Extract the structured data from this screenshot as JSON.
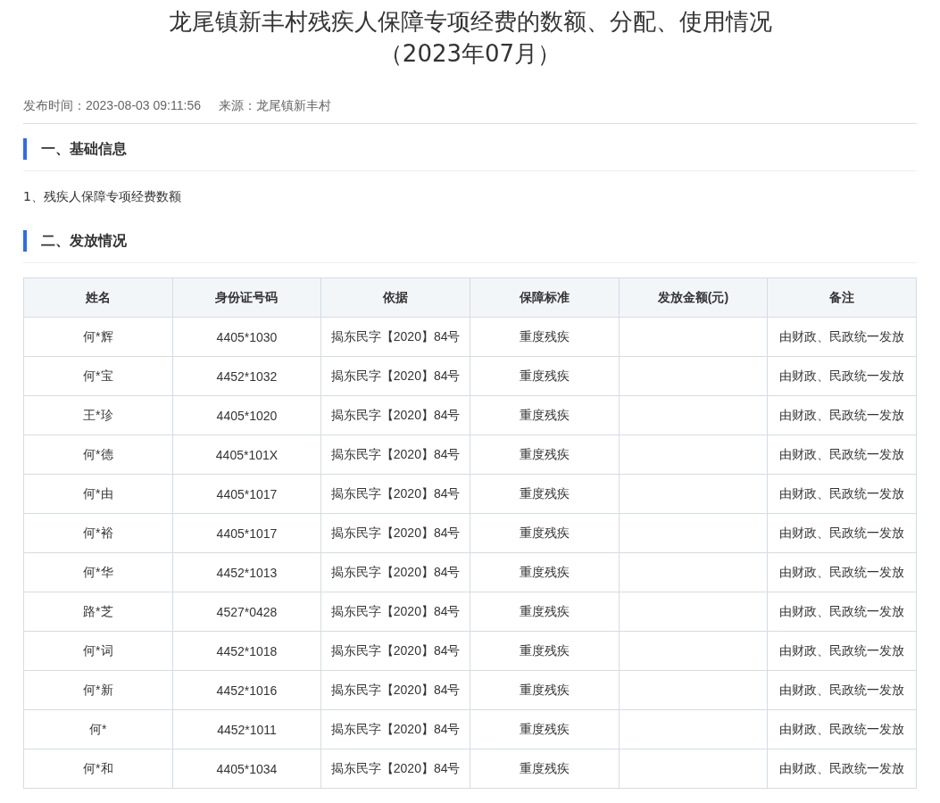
{
  "title_lines": [
    "龙尾镇新丰村残疾人保障专项经费的数额、分配、使用情况",
    "（2023年07月）"
  ],
  "meta": {
    "published": "发布时间：2023-08-03 09:11:56",
    "source": "来源：龙尾镇新丰村"
  },
  "sections": [
    {
      "heading": "一、基础信息",
      "kind": "text",
      "paragraphs": [
        "1、残疾人保障专项经费数额"
      ]
    },
    {
      "heading": "二、发放情况",
      "kind": "table",
      "table": {
        "columns": [
          "姓名",
          "身份证号码",
          "依据",
          "保障标准",
          "发放金额(元)",
          "备注"
        ],
        "rows": [
          [
            "何*辉",
            "4405*1030",
            "揭东民字【2020】84号",
            "重度残疾",
            "",
            "由财政、民政统一发放"
          ],
          [
            "何*宝",
            "4452*1032",
            "揭东民字【2020】84号",
            "重度残疾",
            "",
            "由财政、民政统一发放"
          ],
          [
            "王*珍",
            "4405*1020",
            "揭东民字【2020】84号",
            "重度残疾",
            "",
            "由财政、民政统一发放"
          ],
          [
            "何*德",
            "4405*101X",
            "揭东民字【2020】84号",
            "重度残疾",
            "",
            "由财政、民政统一发放"
          ],
          [
            "何*由",
            "4405*1017",
            "揭东民字【2020】84号",
            "重度残疾",
            "",
            "由财政、民政统一发放"
          ],
          [
            "何*裕",
            "4405*1017",
            "揭东民字【2020】84号",
            "重度残疾",
            "",
            "由财政、民政统一发放"
          ],
          [
            "何*华",
            "4452*1013",
            "揭东民字【2020】84号",
            "重度残疾",
            "",
            "由财政、民政统一发放"
          ],
          [
            "路*芝",
            "4527*0428",
            "揭东民字【2020】84号",
            "重度残疾",
            "",
            "由财政、民政统一发放"
          ],
          [
            "何*词",
            "4452*1018",
            "揭东民字【2020】84号",
            "重度残疾",
            "",
            "由财政、民政统一发放"
          ],
          [
            "何*新",
            "4452*1016",
            "揭东民字【2020】84号",
            "重度残疾",
            "",
            "由财政、民政统一发放"
          ],
          [
            "何*",
            "4452*1011",
            "揭东民字【2020】84号",
            "重度残疾",
            "",
            "由财政、民政统一发放"
          ],
          [
            "何*和",
            "4405*1034",
            "揭东民字【2020】84号",
            "重度残疾",
            "",
            "由财政、民政统一发放"
          ]
        ]
      }
    }
  ]
}
